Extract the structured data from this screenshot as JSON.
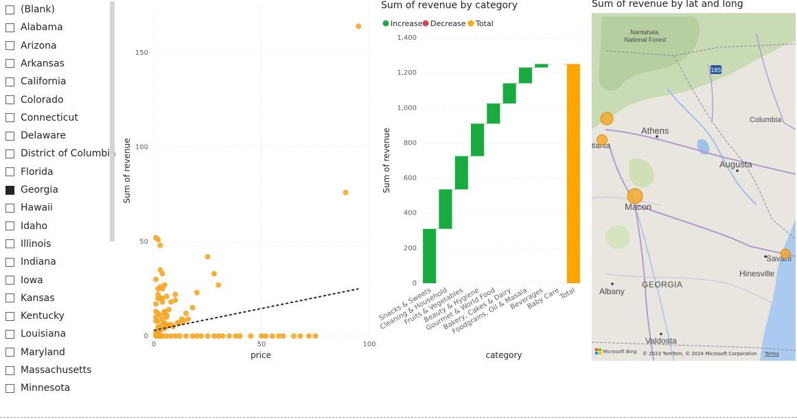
{
  "slicer": {
    "items": [
      {
        "label": "(Blank)",
        "checked": false
      },
      {
        "label": "Alabama",
        "checked": false
      },
      {
        "label": "Arizona",
        "checked": false
      },
      {
        "label": "Arkansas",
        "checked": false
      },
      {
        "label": "California",
        "checked": false
      },
      {
        "label": "Colorado",
        "checked": false
      },
      {
        "label": "Connecticut",
        "checked": false
      },
      {
        "label": "Delaware",
        "checked": false
      },
      {
        "label": "District of Columbia",
        "checked": false
      },
      {
        "label": "Florida",
        "checked": false
      },
      {
        "label": "Georgia",
        "checked": true
      },
      {
        "label": "Hawaii",
        "checked": false
      },
      {
        "label": "Idaho",
        "checked": false
      },
      {
        "label": "Illinois",
        "checked": false
      },
      {
        "label": "Indiana",
        "checked": false
      },
      {
        "label": "Iowa",
        "checked": false
      },
      {
        "label": "Kansas",
        "checked": false
      },
      {
        "label": "Kentucky",
        "checked": false
      },
      {
        "label": "Louisiana",
        "checked": false
      },
      {
        "label": "Maryland",
        "checked": false
      },
      {
        "label": "Massachusetts",
        "checked": false
      },
      {
        "label": "Minnesota",
        "checked": false
      }
    ]
  },
  "chart_data": [
    {
      "type": "scatter",
      "title": "",
      "xlabel": "price",
      "ylabel": "Sum of revenue",
      "xlim": [
        0,
        100
      ],
      "ylim": [
        0,
        175
      ],
      "xticks": [
        "0",
        "50",
        "100"
      ],
      "yticks": [
        "0",
        "50",
        "100",
        "150"
      ],
      "color": "#F5A623",
      "trendline": {
        "style": "dashed",
        "color": "#252423",
        "from": [
          0,
          3
        ],
        "to": [
          95,
          25
        ]
      },
      "x": [
        1,
        2,
        3,
        4,
        5,
        3,
        2,
        4,
        1,
        6,
        8,
        10,
        2,
        3,
        5,
        1,
        2,
        4,
        7,
        9,
        12,
        14,
        16,
        3,
        2,
        1,
        5,
        6,
        8,
        11,
        13,
        15,
        18,
        20,
        25,
        28,
        30,
        3,
        4,
        2,
        1,
        6,
        7,
        10,
        3,
        2,
        1,
        4,
        5,
        2,
        3,
        1,
        2,
        4,
        6,
        8,
        10,
        12,
        15,
        18,
        20,
        22,
        25,
        28,
        30,
        32,
        35,
        38,
        40,
        45,
        50,
        52,
        55,
        58,
        60,
        65,
        68,
        72,
        75,
        95,
        89,
        1,
        2,
        3,
        4,
        5,
        6,
        1,
        2,
        3
      ],
      "y": [
        52,
        51,
        48,
        33,
        27,
        35,
        20,
        20,
        17,
        21,
        18,
        19,
        12,
        11,
        13,
        10,
        8,
        9,
        6,
        5,
        7,
        8,
        9,
        3,
        2,
        1,
        4,
        5,
        6,
        7,
        9,
        12,
        15,
        23,
        42,
        33,
        27,
        26,
        25,
        22,
        13,
        11,
        14,
        22,
        4,
        3,
        2,
        6,
        7,
        0,
        0,
        0,
        0,
        0,
        0,
        0,
        0,
        0,
        0,
        0,
        0,
        0,
        0,
        0,
        0,
        0,
        0,
        0,
        0,
        0,
        0,
        0,
        0,
        0,
        0,
        0,
        0,
        0,
        0,
        164,
        76,
        30,
        25,
        20,
        18,
        12,
        10,
        8,
        5,
        3
      ]
    },
    {
      "type": "bar",
      "title": "Sum of revenue by category",
      "xlabel": "category",
      "ylabel": "Sum of revenue",
      "ylim": [
        0,
        1400
      ],
      "yticks": [
        "0",
        "200",
        "400",
        "600",
        "800",
        "1,000",
        "1,200",
        "1,400"
      ],
      "legend": [
        {
          "label": "Increase",
          "color": "#1AAB40"
        },
        {
          "label": "Decrease",
          "color": "#D64550"
        },
        {
          "label": "Total",
          "color": "#FFA500"
        }
      ],
      "categories": [
        "Snacks & Sweets",
        "Cleaning & Household",
        "Fruits & Vegetables",
        "Beauty & Hygiene",
        "Gourmet & World Food",
        "Bakery, Cakes & Dairy",
        "Foodgrains, Oil & Masala",
        "Beverages",
        "Baby Care",
        "Total"
      ],
      "values": [
        310,
        225,
        190,
        185,
        115,
        115,
        90,
        20,
        0,
        1250
      ],
      "kinds": [
        "increase",
        "increase",
        "increase",
        "increase",
        "increase",
        "increase",
        "increase",
        "increase",
        "increase",
        "total"
      ]
    }
  ],
  "map": {
    "title": "Sum of revenue by lat and long",
    "labels": {
      "forest": "Nantahala\nNational Forest",
      "athens": "Athens",
      "columbia": "Columbia",
      "atlanta": "tlanta",
      "augusta": "Augusta",
      "macon": "Macon",
      "georgia": "GEORGIA",
      "hinesville": "Hinesville",
      "savannah": "Savanı",
      "albany": "Albany",
      "valdosta": "Valdosta",
      "highway": "185"
    },
    "bubbles": [
      {
        "city": "Atlanta north",
        "lat": 33.9,
        "long": -84.35
      },
      {
        "city": "Atlanta",
        "lat": 33.75,
        "long": -84.39
      },
      {
        "city": "Macon",
        "lat": 32.84,
        "long": -83.63
      },
      {
        "city": "Savannah",
        "lat": 32.08,
        "long": -81.09
      }
    ],
    "attribution": {
      "logo": "Microsoft Bing",
      "copyright": "© 2023 TomTom, © 2024 Microsoft Corporation",
      "terms": "Terms"
    }
  }
}
